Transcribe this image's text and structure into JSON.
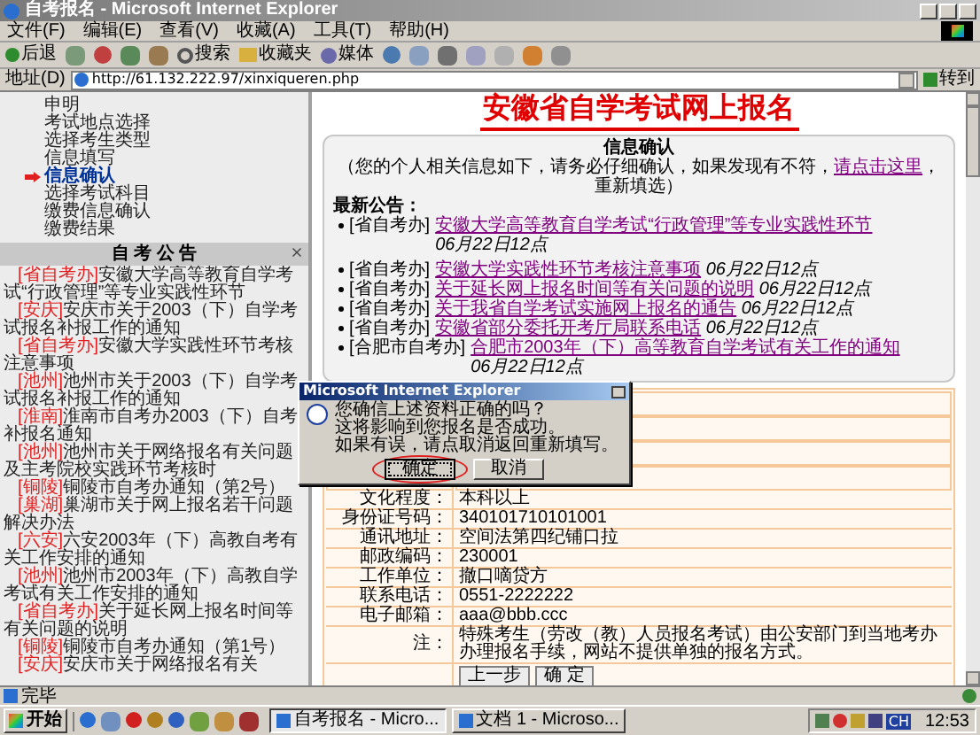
{
  "window": {
    "title": "自考报名 - Microsoft Internet Explorer"
  },
  "menu": [
    "文件(F)",
    "编辑(E)",
    "查看(V)",
    "收藏(A)",
    "工具(T)",
    "帮助(H)"
  ],
  "toolbar": {
    "back": "后退",
    "search": "搜索",
    "favorites": "收藏夹",
    "media": "媒体"
  },
  "address": {
    "label": "地址(D)",
    "url": "http://61.132.222.97/xinxiqueren.php",
    "go": "转到"
  },
  "sidebar": {
    "steps": [
      {
        "label": "申明",
        "selected": false
      },
      {
        "label": "考试地点选择",
        "selected": false
      },
      {
        "label": "选择考生类型",
        "selected": false
      },
      {
        "label": "信息填写",
        "selected": false
      },
      {
        "label": "信息确认",
        "selected": true
      },
      {
        "label": "选择考试科目",
        "selected": false
      },
      {
        "label": "缴费信息确认",
        "selected": false
      },
      {
        "label": "缴费结果",
        "selected": false
      }
    ],
    "notices_title": "自 考 公 告",
    "notices": [
      {
        "tag": "[省自考办]",
        "text": "安徽大学高等教育自学考试“行政管理”等专业实践性环节"
      },
      {
        "tag": "[安庆]",
        "text": "安庆市关于2003（下）自学考试报名补报工作的通知"
      },
      {
        "tag": "[省自考办]",
        "text": "安徽大学实践性环节考核注意事项"
      },
      {
        "tag": "[池州]",
        "text": "池州市关于2003（下）自学考试报名补报工作的通知"
      },
      {
        "tag": "[淮南]",
        "text": "淮南市自考办2003（下）自考补报名通知"
      },
      {
        "tag": "[池州]",
        "text": "池州市关于网络报名有关问题及主考院校实践环节考核时"
      },
      {
        "tag": "[铜陵]",
        "text": "铜陵市自考办通知（第2号）"
      },
      {
        "tag": "[巢湖]",
        "text": "巢湖市关于网上报名若干问题解决办法"
      },
      {
        "tag": "[六安]",
        "text": "六安2003年（下）高教自考有关工作安排的通知"
      },
      {
        "tag": "[池州]",
        "text": "池州市2003年（下）高教自学考试有关工作安排的通知"
      },
      {
        "tag": "[省自考办]",
        "text": "关于延长网上报名时间等有关问题的说明"
      },
      {
        "tag": "[铜陵]",
        "text": "铜陵市自考办通知（第1号）"
      },
      {
        "tag": "[安庆]",
        "text": "安庆市关于网络报名有关"
      }
    ]
  },
  "main": {
    "heading": "安徽省自学考试网上报名",
    "box": {
      "title": "信息确认",
      "intro_before": "（您的个人相关信息如下，请务必仔细确认，如果发现有不符，",
      "intro_link": "请点击这里",
      "intro_after": "，重新填选）",
      "news_title": "最新公告：",
      "news": [
        {
          "source": "[省自考办]",
          "title": "安徽大学高等教育自学考试“行政管理”等专业实践性环节",
          "date": "06月22日12点",
          "gap_before": false
        },
        {
          "source": "[省自考办]",
          "title": "安徽大学实践性环节考核注意事项",
          "date": "06月22日12点",
          "gap_before": true
        },
        {
          "source": "[省自考办]",
          "title": "关于延长网上报名时间等有关问题的说明",
          "date": "06月22日12点",
          "gap_before": false
        },
        {
          "source": "[省自考办]",
          "title": "关于我省自学考试实施网上报名的通告",
          "date": "06月22日12点",
          "gap_before": false
        },
        {
          "source": "[省自考办]",
          "title": "安徽省部分委托开考厅局联系电话",
          "date": "06月22日12点",
          "gap_before": false
        },
        {
          "source": "[合肥市自考办]",
          "title": "合肥市2003年（下）高等教育自学考试有关工作的通知",
          "date": "06月22日12点",
          "gap_before": false
        }
      ]
    },
    "form": {
      "rows": [
        {
          "label": "文化程度：",
          "value": "本科以上"
        },
        {
          "label": "身份证号码：",
          "value": "340101710101001"
        },
        {
          "label": "通讯地址：",
          "value": "空间法第四纪铺口拉"
        },
        {
          "label": "邮政编码：",
          "value": "230001"
        },
        {
          "label": "工作单位：",
          "value": "撤口嘀贷方"
        },
        {
          "label": "联系电话：",
          "value": "0551-2222222"
        },
        {
          "label": "电子邮箱：",
          "value": "aaa@bbb.ccc"
        },
        {
          "label": "注：",
          "value": "特殊考生（劳改（教）人员报名考试）由公安部门到当地考办办理报名手续，网站不提供单独的报名方式。"
        }
      ],
      "buttons": [
        "上一步",
        "确 定"
      ]
    }
  },
  "dialog": {
    "title": "Microsoft Internet Explorer",
    "lines": [
      "您确信上述资料正确的吗？",
      "这将影响到您报名是否成功。",
      "如果有误，请点取消返回重新填写。"
    ],
    "buttons": [
      {
        "label": "确定",
        "selected": true
      },
      {
        "label": "取消",
        "selected": false
      }
    ]
  },
  "status_bar": {
    "text": "完毕"
  },
  "taskbar": {
    "start": "开始",
    "tasks": [
      {
        "label": "自考报名 - Micro...",
        "selected": true
      },
      {
        "label": "文档 1 - Microso...",
        "selected": false
      }
    ],
    "lang": "CH",
    "clock": "12:53"
  }
}
